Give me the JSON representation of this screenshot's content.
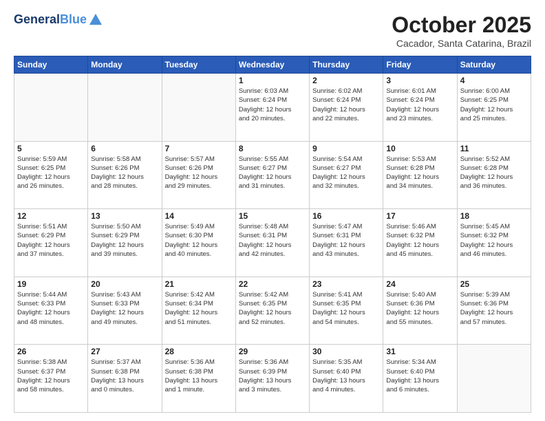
{
  "header": {
    "logo_line1": "General",
    "logo_line2": "Blue",
    "title": "October 2025",
    "location": "Cacador, Santa Catarina, Brazil"
  },
  "weekdays": [
    "Sunday",
    "Monday",
    "Tuesday",
    "Wednesday",
    "Thursday",
    "Friday",
    "Saturday"
  ],
  "weeks": [
    [
      {
        "day": "",
        "info": ""
      },
      {
        "day": "",
        "info": ""
      },
      {
        "day": "",
        "info": ""
      },
      {
        "day": "1",
        "info": "Sunrise: 6:03 AM\nSunset: 6:24 PM\nDaylight: 12 hours\nand 20 minutes."
      },
      {
        "day": "2",
        "info": "Sunrise: 6:02 AM\nSunset: 6:24 PM\nDaylight: 12 hours\nand 22 minutes."
      },
      {
        "day": "3",
        "info": "Sunrise: 6:01 AM\nSunset: 6:24 PM\nDaylight: 12 hours\nand 23 minutes."
      },
      {
        "day": "4",
        "info": "Sunrise: 6:00 AM\nSunset: 6:25 PM\nDaylight: 12 hours\nand 25 minutes."
      }
    ],
    [
      {
        "day": "5",
        "info": "Sunrise: 5:59 AM\nSunset: 6:25 PM\nDaylight: 12 hours\nand 26 minutes."
      },
      {
        "day": "6",
        "info": "Sunrise: 5:58 AM\nSunset: 6:26 PM\nDaylight: 12 hours\nand 28 minutes."
      },
      {
        "day": "7",
        "info": "Sunrise: 5:57 AM\nSunset: 6:26 PM\nDaylight: 12 hours\nand 29 minutes."
      },
      {
        "day": "8",
        "info": "Sunrise: 5:55 AM\nSunset: 6:27 PM\nDaylight: 12 hours\nand 31 minutes."
      },
      {
        "day": "9",
        "info": "Sunrise: 5:54 AM\nSunset: 6:27 PM\nDaylight: 12 hours\nand 32 minutes."
      },
      {
        "day": "10",
        "info": "Sunrise: 5:53 AM\nSunset: 6:28 PM\nDaylight: 12 hours\nand 34 minutes."
      },
      {
        "day": "11",
        "info": "Sunrise: 5:52 AM\nSunset: 6:28 PM\nDaylight: 12 hours\nand 36 minutes."
      }
    ],
    [
      {
        "day": "12",
        "info": "Sunrise: 5:51 AM\nSunset: 6:29 PM\nDaylight: 12 hours\nand 37 minutes."
      },
      {
        "day": "13",
        "info": "Sunrise: 5:50 AM\nSunset: 6:29 PM\nDaylight: 12 hours\nand 39 minutes."
      },
      {
        "day": "14",
        "info": "Sunrise: 5:49 AM\nSunset: 6:30 PM\nDaylight: 12 hours\nand 40 minutes."
      },
      {
        "day": "15",
        "info": "Sunrise: 5:48 AM\nSunset: 6:31 PM\nDaylight: 12 hours\nand 42 minutes."
      },
      {
        "day": "16",
        "info": "Sunrise: 5:47 AM\nSunset: 6:31 PM\nDaylight: 12 hours\nand 43 minutes."
      },
      {
        "day": "17",
        "info": "Sunrise: 5:46 AM\nSunset: 6:32 PM\nDaylight: 12 hours\nand 45 minutes."
      },
      {
        "day": "18",
        "info": "Sunrise: 5:45 AM\nSunset: 6:32 PM\nDaylight: 12 hours\nand 46 minutes."
      }
    ],
    [
      {
        "day": "19",
        "info": "Sunrise: 5:44 AM\nSunset: 6:33 PM\nDaylight: 12 hours\nand 48 minutes."
      },
      {
        "day": "20",
        "info": "Sunrise: 5:43 AM\nSunset: 6:33 PM\nDaylight: 12 hours\nand 49 minutes."
      },
      {
        "day": "21",
        "info": "Sunrise: 5:42 AM\nSunset: 6:34 PM\nDaylight: 12 hours\nand 51 minutes."
      },
      {
        "day": "22",
        "info": "Sunrise: 5:42 AM\nSunset: 6:35 PM\nDaylight: 12 hours\nand 52 minutes."
      },
      {
        "day": "23",
        "info": "Sunrise: 5:41 AM\nSunset: 6:35 PM\nDaylight: 12 hours\nand 54 minutes."
      },
      {
        "day": "24",
        "info": "Sunrise: 5:40 AM\nSunset: 6:36 PM\nDaylight: 12 hours\nand 55 minutes."
      },
      {
        "day": "25",
        "info": "Sunrise: 5:39 AM\nSunset: 6:36 PM\nDaylight: 12 hours\nand 57 minutes."
      }
    ],
    [
      {
        "day": "26",
        "info": "Sunrise: 5:38 AM\nSunset: 6:37 PM\nDaylight: 12 hours\nand 58 minutes."
      },
      {
        "day": "27",
        "info": "Sunrise: 5:37 AM\nSunset: 6:38 PM\nDaylight: 13 hours\nand 0 minutes."
      },
      {
        "day": "28",
        "info": "Sunrise: 5:36 AM\nSunset: 6:38 PM\nDaylight: 13 hours\nand 1 minute."
      },
      {
        "day": "29",
        "info": "Sunrise: 5:36 AM\nSunset: 6:39 PM\nDaylight: 13 hours\nand 3 minutes."
      },
      {
        "day": "30",
        "info": "Sunrise: 5:35 AM\nSunset: 6:40 PM\nDaylight: 13 hours\nand 4 minutes."
      },
      {
        "day": "31",
        "info": "Sunrise: 5:34 AM\nSunset: 6:40 PM\nDaylight: 13 hours\nand 6 minutes."
      },
      {
        "day": "",
        "info": ""
      }
    ]
  ]
}
